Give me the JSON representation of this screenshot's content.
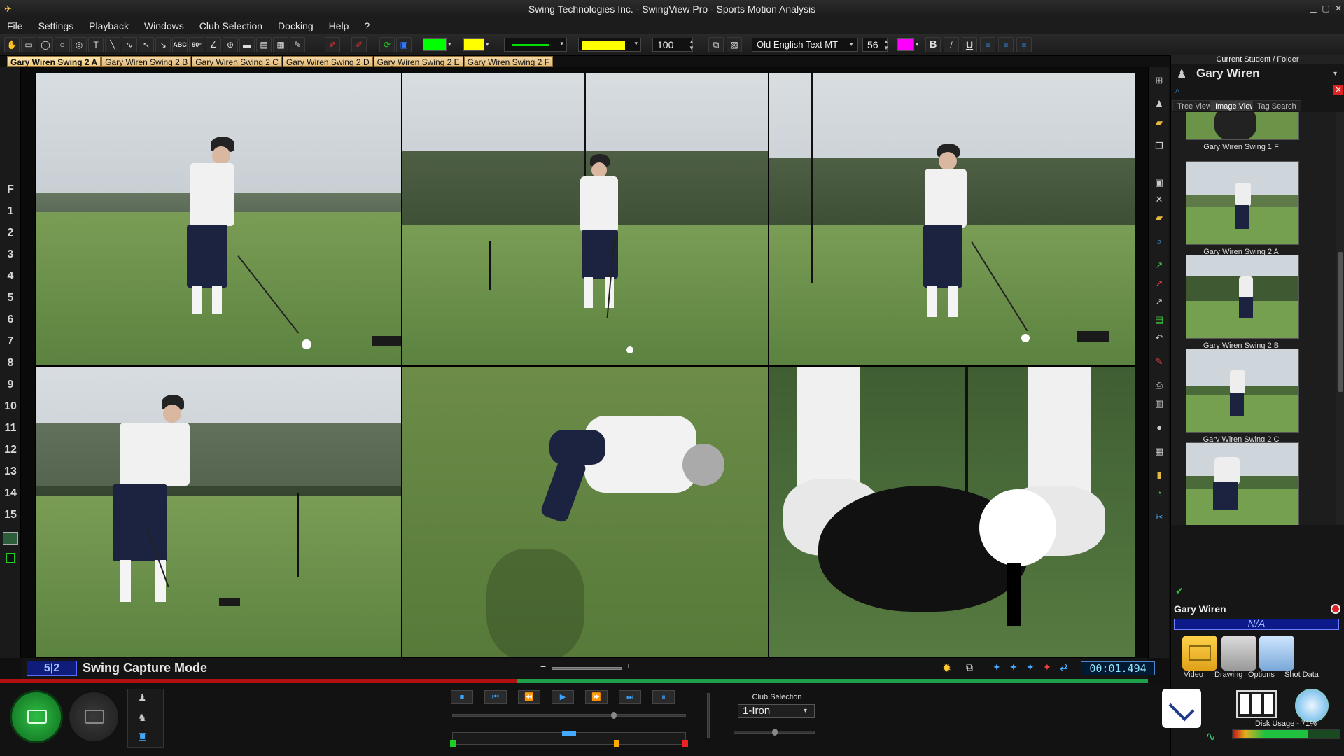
{
  "window": {
    "title": "Swing Technologies Inc. - SwingView Pro - Sports Motion Analysis",
    "app_icon": "swingview-logo-icon"
  },
  "menu": [
    "File",
    "Settings",
    "Playback",
    "Windows",
    "Club Selection",
    "Docking",
    "Help",
    "?"
  ],
  "toolbar": {
    "tools": [
      "hand-icon",
      "rectangle-icon",
      "ellipse-icon",
      "circle-icon",
      "filled-circle-icon",
      "text-icon",
      "line-icon",
      "freehand-icon",
      "arrow-icon",
      "arrow2-icon",
      "abc-text-icon",
      "angle-90-icon",
      "angle-icon",
      "circle-target-icon",
      "ruler-icon",
      "ruler2-icon",
      "grid-icon",
      "pen-icon"
    ],
    "angle_label": "90°",
    "abc_label": "ABC",
    "line_color": "#00ff00",
    "fill_color": "#ffff00",
    "line_fill_color": "#ffff00",
    "opacity_value": "100",
    "font_name": "Old English Text MT",
    "font_size": "56",
    "text_color": "#ff00ff",
    "bold_label": "B",
    "underline_label": "U"
  },
  "tabs": [
    "Gary Wiren Swing 2 A",
    "Gary Wiren Swing 2 B",
    "Gary Wiren Swing 2 C",
    "Gary Wiren Swing 2 D",
    "Gary Wiren Swing 2 E",
    "Gary Wiren Swing 2 F"
  ],
  "frame_markers": [
    "F",
    "1",
    "2",
    "3",
    "4",
    "5",
    "6",
    "7",
    "8",
    "9",
    "10",
    "11",
    "12",
    "13",
    "14",
    "15"
  ],
  "panel": {
    "header": "Current Student / Folder",
    "student": "Gary Wiren",
    "view_tabs": [
      "Tree View",
      "Image View",
      "Tag Search"
    ],
    "active_tab": "Image View",
    "thumbnails": [
      "Gary Wiren Swing 1 F",
      "Gary Wiren Swing 2 A",
      "Gary Wiren Swing 2 B",
      "Gary Wiren Swing 2 C"
    ],
    "player_name": "Gary Wiren",
    "na_label": "N/A",
    "buttons": [
      "Video",
      "Drawing",
      "Options",
      "Shot Data"
    ]
  },
  "status": {
    "mode": "Swing Capture Mode",
    "mode_badge": "5|2",
    "timecode": "00:01.494"
  },
  "bottom": {
    "club_selection_label": "Club Selection",
    "club_value": "1-Iron",
    "disk_usage": "Disk Usage - 71%",
    "disk_usage_fraction": 0.71
  }
}
